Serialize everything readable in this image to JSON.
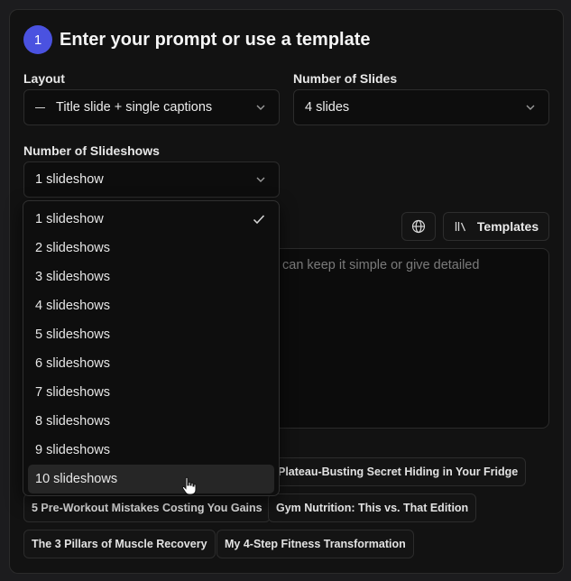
{
  "header": {
    "step": "1",
    "title": "Enter your prompt or use a template"
  },
  "layout": {
    "label": "Layout",
    "value": "Title slide + single captions"
  },
  "slides": {
    "label": "Number of Slides",
    "value": "4 slides"
  },
  "slideshows": {
    "label": "Number of Slideshows",
    "value": "1 slideshow",
    "options": [
      "1 slideshow",
      "2 slideshows",
      "3 slideshows",
      "4 slideshows",
      "5 slideshows",
      "6 slideshows",
      "7 slideshows",
      "8 slideshows",
      "9 slideshows",
      "10 slideshows"
    ],
    "selected_index": 0,
    "hovered_index": 9
  },
  "toolbar": {
    "templates_label": "Templates"
  },
  "prompt": {
    "placeholder_visible": "can keep it simple or give detailed"
  },
  "templates": {
    "chips": [
      "Plateau-Busting Secret Hiding in Your Fridge",
      "5 Pre-Workout Mistakes Costing You Gains",
      "Gym Nutrition: This vs. That Edition",
      "The 3 Pillars of Muscle Recovery",
      "My 4-Step Fitness Transformation"
    ]
  },
  "colors": {
    "accent": "#4a52e0",
    "background": "#121212"
  }
}
